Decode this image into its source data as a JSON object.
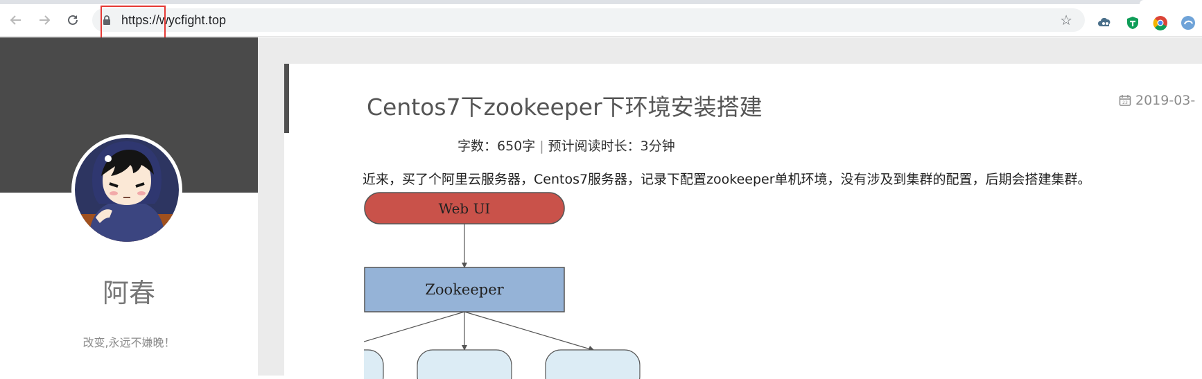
{
  "browser": {
    "url": "https://wycfight.top",
    "nav": {
      "back": "back",
      "forward": "forward",
      "reload": "reload"
    }
  },
  "sidebar": {
    "author": "阿春",
    "motto": "改变,永远不嫌晚！"
  },
  "post": {
    "title": "Centos7下zookeeper下环境安装搭建",
    "date": "2019-03-",
    "word_count_label": "字数：650字",
    "read_time_label": "预计阅读时长：3分钟",
    "separator": "|",
    "intro": "近来，买了个阿里云服务器，Centos7服务器，记录下配置zookeeper单机环境，没有涉及到集群的配置，后期会搭建集群。",
    "diagram": {
      "top_node": "Web UI",
      "middle_node": "Zookeeper"
    }
  },
  "colors": {
    "banner": "#4a4a4a",
    "webui_node": "#c9524a",
    "zookeeper_node": "#95b3d7",
    "highlight_box": "#e53935"
  }
}
